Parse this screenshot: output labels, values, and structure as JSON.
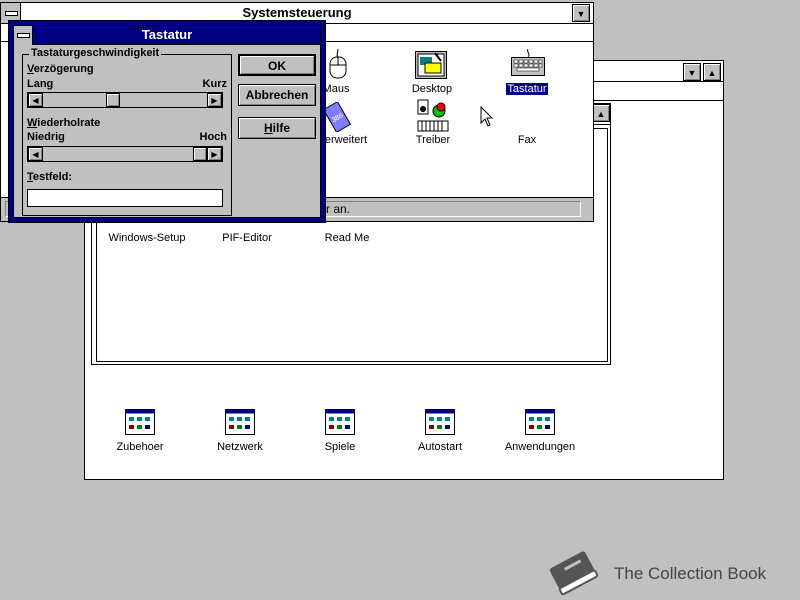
{
  "programmanager": {
    "main_group_icons": [
      {
        "label": "Windows-Setup"
      },
      {
        "label": "PIF-Editor"
      },
      {
        "label": "Read Me"
      }
    ],
    "group_icons": [
      {
        "label": "Zubehoer"
      },
      {
        "label": "Netzwerk"
      },
      {
        "label": "Spiele"
      },
      {
        "label": "Autostart"
      },
      {
        "label": "Anwendungen"
      }
    ]
  },
  "systemsteuerung": {
    "title": "Systemsteuerung",
    "icons": [
      {
        "label": "Maus",
        "icon": "mouse-icon"
      },
      {
        "label": "Desktop",
        "icon": "desktop-icon"
      },
      {
        "label": "Tastatur",
        "icon": "keyboard-icon",
        "selected": true
      },
      {
        "label": "erweitert",
        "icon": "memory-chip-icon"
      },
      {
        "label": "Treiber",
        "icon": "drivers-icon"
      },
      {
        "label": "Fax",
        "icon": "fax-icon"
      }
    ],
    "status_text": "r an."
  },
  "dialog": {
    "title": "Tastatur",
    "group_title": "Tastaturgeschwindigkeit",
    "delay": {
      "label_prefix": "V",
      "label_rest": "erzögerung",
      "min_label": "Lang",
      "max_label": "Kurz",
      "value_fraction": 0.42
    },
    "repeat": {
      "label_prefix": "W",
      "label_rest": "iederholrate",
      "min_label": "Niedrig",
      "max_label": "Hoch",
      "value_fraction": 1.0
    },
    "testfield": {
      "label_prefix": "T",
      "label_rest": "estfeld:",
      "value": ""
    },
    "buttons": {
      "ok": "OK",
      "cancel": "Abbrechen",
      "help_prefix": "H",
      "help_rest": "ilfe"
    }
  },
  "watermark": {
    "text": "The Collection Book",
    "icon": "book-icon"
  },
  "colors": {
    "desktop": "#c0c0c0",
    "active_title": "#000080",
    "window": "#ffffff"
  }
}
